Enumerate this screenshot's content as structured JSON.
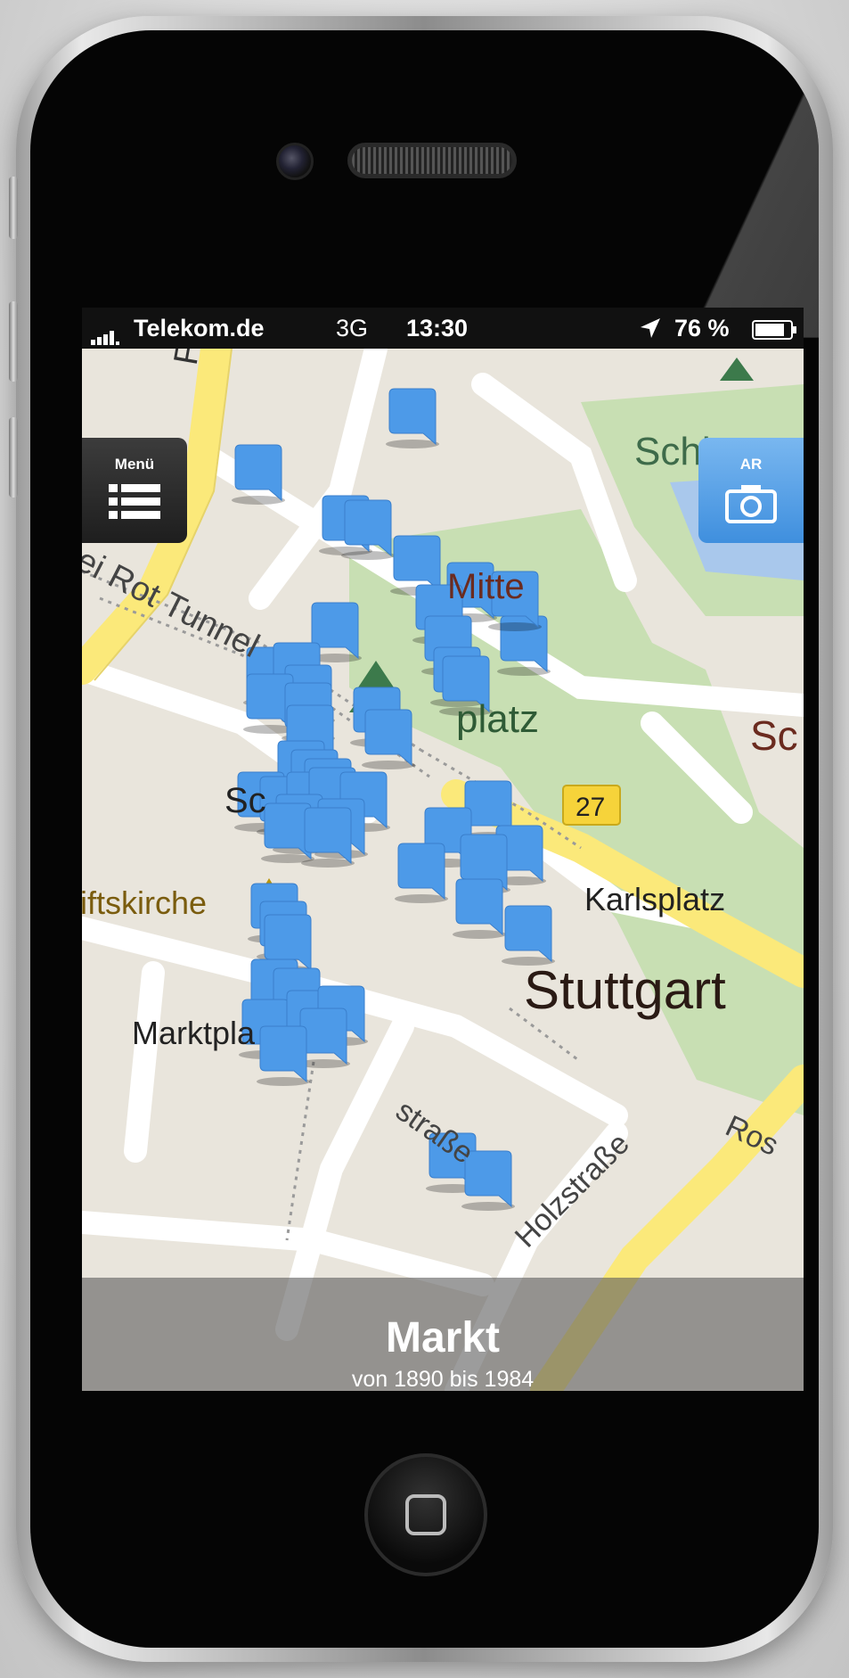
{
  "status": {
    "carrier": "Telekom.de",
    "network": "3G",
    "time": "13:30",
    "battery": "76 %"
  },
  "map": {
    "labels": {
      "fri": "Fri",
      "schloss_top": "Schloss",
      "tunnel": "ei Rot Tunnel",
      "mitte": "Mitte",
      "platz": "platz",
      "sc_right": "Sc",
      "sc_left": "Sc",
      "route": "27",
      "stiftskirche": "iftskirche",
      "karlsplatz": "Karlsplatz",
      "city": "Stuttgart",
      "marktplatz": "Marktpla",
      "strasse1": "straße",
      "strasse2": "Holzstraße",
      "ros": "Ros"
    },
    "marker_count": 52
  },
  "menu_button": {
    "label": "Menü",
    "icon": "list-icon"
  },
  "ar_button": {
    "label": "AR",
    "icon": "camera-icon"
  },
  "footer": {
    "title": "Markt",
    "subtitle": "von 1890 bis 1984"
  },
  "colors": {
    "marker": "#4d9ae8",
    "road_major": "#fbe97a",
    "park": "#c8dfb3",
    "water": "#a9c8ec"
  }
}
